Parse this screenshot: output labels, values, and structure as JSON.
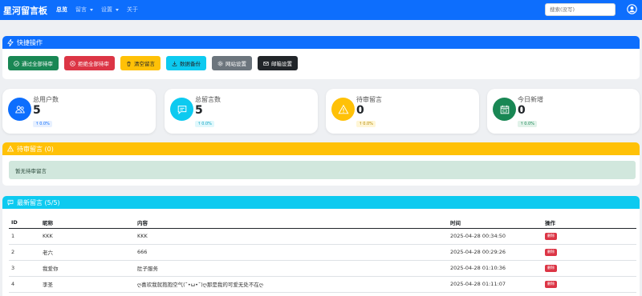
{
  "navbar": {
    "brand": "星河留言板",
    "links": [
      {
        "label": "总览"
      },
      {
        "label": "留言"
      },
      {
        "label": "设置"
      },
      {
        "label": "关于"
      }
    ],
    "search_placeholder": "搜索(没写)",
    "accent": "#0d6efd"
  },
  "quick_actions": {
    "title": "快捷操作",
    "buttons": [
      {
        "label": "通过全部待审",
        "icon": "check-circle-icon",
        "color": "#198754"
      },
      {
        "label": "拒绝全部待审",
        "icon": "x-circle-icon",
        "color": "#dc3545"
      },
      {
        "label": "清空留言",
        "icon": "trash-icon",
        "color": "#ffc107"
      },
      {
        "label": "数据备份",
        "icon": "download-icon",
        "color": "#0dcaf0"
      },
      {
        "label": "网站设置",
        "icon": "gear-icon",
        "color": "#6c757d"
      },
      {
        "label": "邮箱设置",
        "icon": "envelope-icon",
        "color": "#212529"
      }
    ]
  },
  "stats": [
    {
      "label": "总用户数",
      "value": "5",
      "change": "0.0%",
      "icon": "users-icon",
      "color": "#0d6efd",
      "badge_bg": "#e7f0ff",
      "badge_color": "#0d6efd"
    },
    {
      "label": "总留言数",
      "value": "5",
      "change": "0.0%",
      "icon": "chat-icon",
      "color": "#0dcaf0",
      "badge_bg": "#e0f8fc",
      "badge_color": "#0aa2c0"
    },
    {
      "label": "待审留言",
      "value": "0",
      "change": "0.0%",
      "icon": "warning-icon",
      "color": "#ffc107",
      "badge_bg": "#fff6d6",
      "badge_color": "#b58900"
    },
    {
      "label": "今日新增",
      "value": "0",
      "change": "0.0%",
      "icon": "calendar-icon",
      "color": "#198754",
      "badge_bg": "#e1f2e9",
      "badge_color": "#198754"
    }
  ],
  "pending": {
    "title": "待审留言 (0)",
    "empty_text": "暂无待审留言"
  },
  "latest": {
    "title": "最新留言 (5/5)",
    "columns": [
      "ID",
      "昵称",
      "内容",
      "时间",
      "操作"
    ],
    "rows": [
      {
        "id": "1",
        "nickname": "KKK",
        "content": "KKK",
        "time": "2025-04-28 00:34:50",
        "action": "删除"
      },
      {
        "id": "2",
        "nickname": "老六",
        "content": "666",
        "time": "2025-04-28 00:29:26",
        "action": "删除"
      },
      {
        "id": "3",
        "nickname": "我爱你",
        "content": "肚子服务",
        "time": "2025-04-28 01:10:36",
        "action": "删除"
      },
      {
        "id": "4",
        "nickname": "李圣",
        "content": "ღ喜欢我就抱抱空气(˘•ω•˘)ღ那是我的可爱无处不在ღ",
        "time": "2025-04-28 01:11:07",
        "action": "删除"
      }
    ]
  }
}
